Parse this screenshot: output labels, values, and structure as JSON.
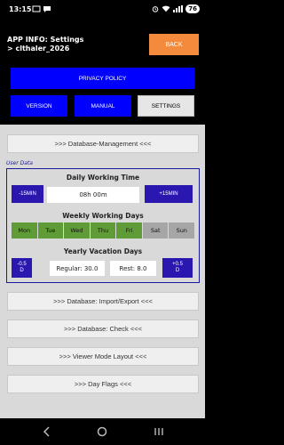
{
  "status": {
    "time": "13:15",
    "battery": "76"
  },
  "header": {
    "title_line1": "APP INFO: Settings",
    "title_line2": "> clthaler_2026",
    "back_label": "BACK"
  },
  "nav": {
    "privacy": "PRIVACY POLICY",
    "version": "VERSION",
    "manual": "MANUAL",
    "settings": "SETTINGS"
  },
  "sections": {
    "db_management": ">>>   Database-Management   <<<",
    "db_import_export": ">>>   Database: Import/Export   <<<",
    "db_check": ">>>   Database: Check   <<<",
    "viewer_mode": ">>>   Viewer Mode Layout   <<<",
    "day_flags": ">>>   Day Flags   <<<"
  },
  "user_data": {
    "label": "User Data",
    "daily_title": "Daily Working Time",
    "minus15": "-15MIN",
    "plus15": "+15MIN",
    "daily_value": "08h 00m",
    "weekly_title": "Weekly Working Days",
    "days": [
      "Mon",
      "Tue",
      "Wed",
      "Thu",
      "Fri",
      "Sat",
      "Sun"
    ],
    "yearly_title": "Yearly Vacation Days",
    "minus05": "-0.5\nD",
    "plus05": "+0.5\nD",
    "regular": "Regular: 30.0",
    "rest": "Rest: 8.0"
  }
}
